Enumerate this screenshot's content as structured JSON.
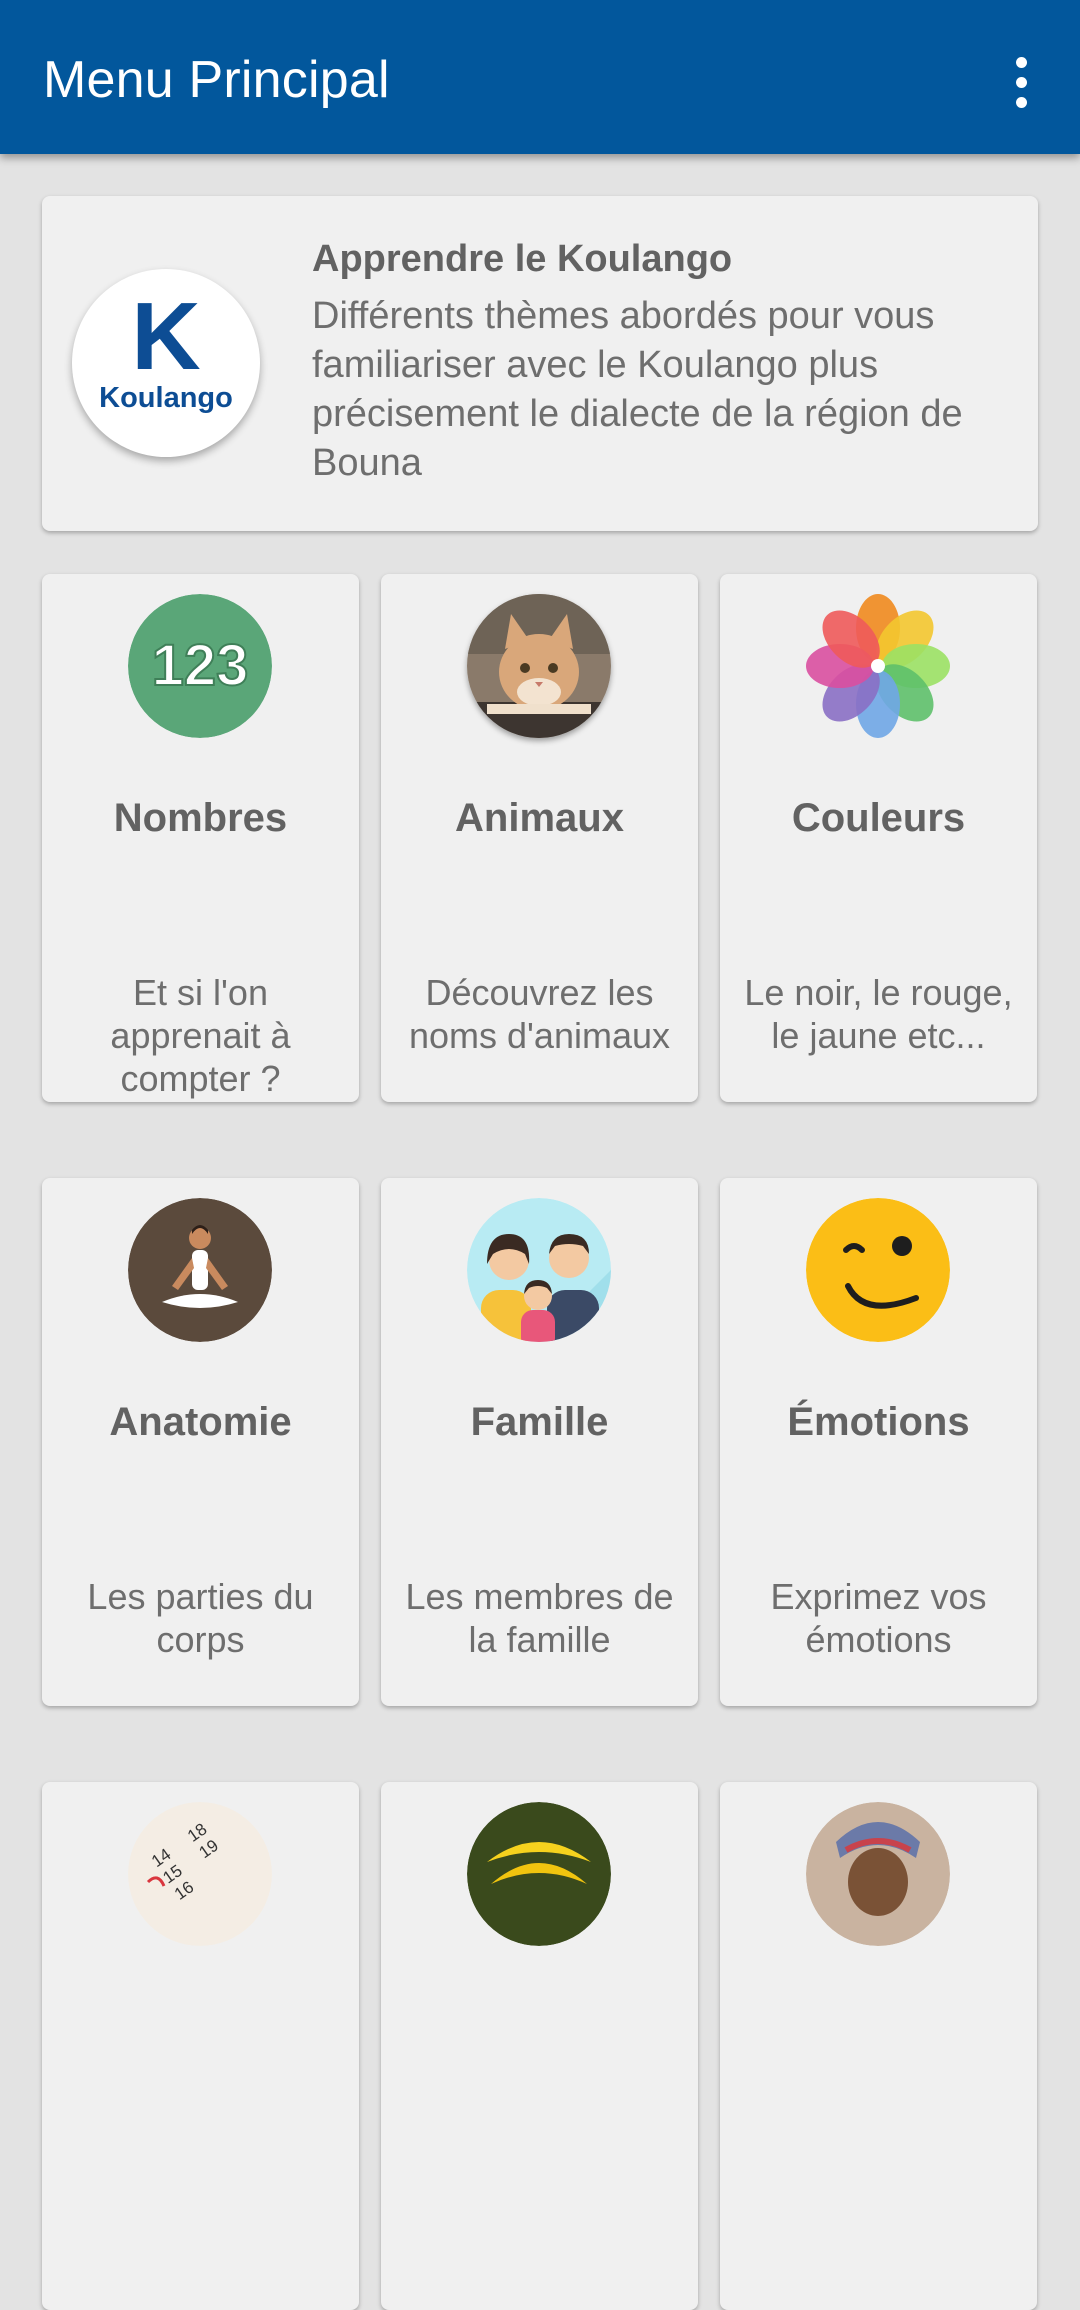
{
  "app_bar": {
    "title": "Menu Principal"
  },
  "hero": {
    "logo_letter": "K",
    "logo_name": "Koulango",
    "title": "Apprendre le Koulango",
    "description": "Différents thèmes abordés pour vous familiariser avec le Koulango plus précisement le dialecte de la région de Bouna"
  },
  "tiles": [
    {
      "title": "Nombres",
      "description": "Et si l'on apprenait à compter ?",
      "icon": "numbers-123-icon",
      "icon_text": "123"
    },
    {
      "title": "Animaux",
      "description": "Découvrez les noms d'animaux",
      "icon": "cat-photo-icon"
    },
    {
      "title": "Couleurs",
      "description": "Le noir, le rouge, le jaune etc...",
      "icon": "color-petals-icon"
    },
    {
      "title": "Anatomie",
      "description": "Les parties du corps",
      "icon": "yoga-person-icon"
    },
    {
      "title": "Famille",
      "description": "Les membres de la famille",
      "icon": "family-icon"
    },
    {
      "title": "Émotions",
      "description": "Exprimez vos émotions",
      "icon": "wink-emoji-icon"
    }
  ],
  "partial_tiles": [
    {
      "icon": "calendar-icon",
      "calendar_numbers": [
        "14",
        "15",
        "16",
        "18",
        "19"
      ]
    },
    {
      "icon": "bananas-icon"
    },
    {
      "icon": "person-photo-icon"
    }
  ],
  "colors": {
    "app_bar": "#02579c",
    "background": "#e3e3e3",
    "card": "#f0f0f0",
    "brand_blue": "#0d4d94"
  }
}
